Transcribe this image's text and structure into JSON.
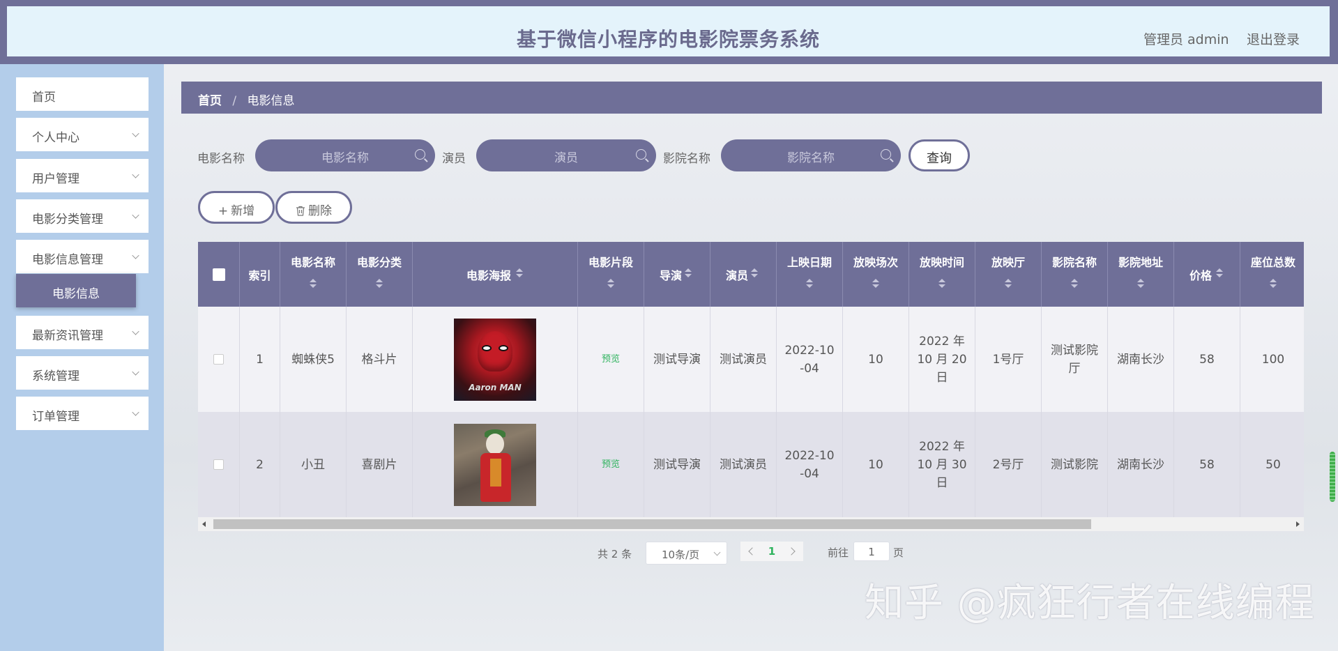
{
  "header": {
    "title": "基于微信小程序的电影院票务系统",
    "user_label": "管理员 admin",
    "logout_label": "退出登录"
  },
  "sidebar": {
    "items": [
      {
        "label": "首页",
        "has_children": false
      },
      {
        "label": "个人中心",
        "has_children": true
      },
      {
        "label": "用户管理",
        "has_children": true
      },
      {
        "label": "电影分类管理",
        "has_children": true
      },
      {
        "label": "电影信息管理",
        "has_children": true,
        "expanded": true
      },
      {
        "label": "最新资讯管理",
        "has_children": true
      },
      {
        "label": "系统管理",
        "has_children": true
      },
      {
        "label": "订单管理",
        "has_children": true
      }
    ],
    "active_subitem": "电影信息"
  },
  "breadcrumb": {
    "home": "首页",
    "separator": "/",
    "current": "电影信息"
  },
  "search": {
    "movie_name_label": "电影名称",
    "movie_name_placeholder": "电影名称",
    "actor_label": "演员",
    "actor_placeholder": "演员",
    "cinema_label": "影院名称",
    "cinema_placeholder": "影院名称",
    "query_button": "查询"
  },
  "actions": {
    "add_icon": "+",
    "add_label": "新增",
    "delete_label": "删除"
  },
  "table": {
    "headers": {
      "index": "索引",
      "movie_name": "电影名称",
      "category": "电影分类",
      "poster": "电影海报",
      "clip": "电影片段",
      "director": "导演",
      "actor": "演员",
      "release_date": "上映日期",
      "show_count": "放映场次",
      "show_time": "放映时间",
      "hall": "放映厅",
      "cinema_name": "影院名称",
      "cinema_address": "影院地址",
      "price": "价格",
      "seats": "座位总数"
    },
    "rows": [
      {
        "index": "1",
        "movie_name": "蜘蛛侠5",
        "category": "格斗片",
        "poster_caption": "Aaron MAN",
        "clip": "预览",
        "director": "测试导演",
        "actor": "测试演员",
        "release_date_1": "2022-10",
        "release_date_2": "-04",
        "show_count": "10",
        "show_time_1": "2022 年",
        "show_time_2": "10 月 20",
        "show_time_3": "日",
        "hall": "1号厅",
        "cinema_name_1": "测试影院",
        "cinema_name_2": "厅",
        "cinema_address": "湖南长沙",
        "price": "58",
        "seats": "100"
      },
      {
        "index": "2",
        "movie_name": "小丑",
        "category": "喜剧片",
        "clip": "预览",
        "director": "测试导演",
        "actor": "测试演员",
        "release_date_1": "2022-10",
        "release_date_2": "-04",
        "show_count": "10",
        "show_time_1": "2022 年",
        "show_time_2": "10 月 30",
        "show_time_3": "日",
        "hall": "2号厅",
        "cinema_name": "测试影院",
        "cinema_address": "湖南长沙",
        "price": "58",
        "seats": "50"
      }
    ]
  },
  "pagination": {
    "total": "共 2 条",
    "page_size": "10条/页",
    "current_page": "1",
    "goto_label": "前往",
    "goto_value": "1",
    "page_suffix": "页"
  },
  "watermark": "知乎 @疯狂行者在线编程",
  "colors": {
    "accent": "#6f6f98",
    "sidebar_bg": "#b3cdea",
    "header_bg": "#e4f3fb",
    "link_green": "#2fb35e"
  }
}
